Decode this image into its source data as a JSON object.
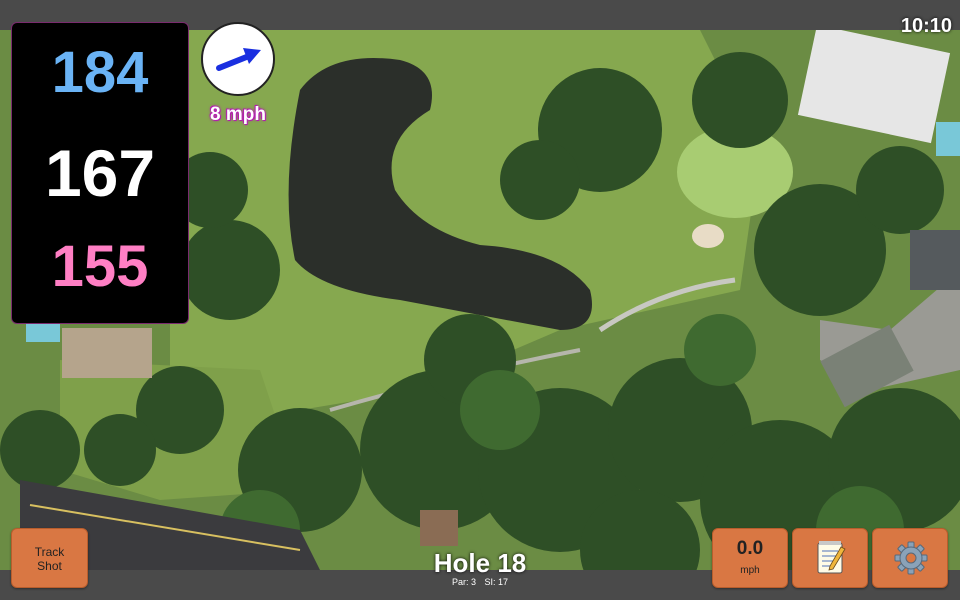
{
  "status": {
    "time": "10:10"
  },
  "yardage": {
    "back": "184",
    "middle": "167",
    "front": "155"
  },
  "wind": {
    "speed_label": "8 mph",
    "direction_icon": "arrow-northeast"
  },
  "buttons": {
    "track_shot_line1": "Track",
    "track_shot_line2": "Shot",
    "speed_value": "0.0",
    "speed_unit": "mph",
    "notes_icon": "notepad-icon",
    "settings_icon": "gear-icon"
  },
  "hole": {
    "title": "Hole 18",
    "par": "Par: 3",
    "si": "SI: 17"
  },
  "colors": {
    "back_distance": "#6ab3f5",
    "middle_distance": "#ffffff",
    "front_distance": "#ff7fc4",
    "button_accent": "#d97743",
    "wind_label_outline": "#b51cb2"
  }
}
